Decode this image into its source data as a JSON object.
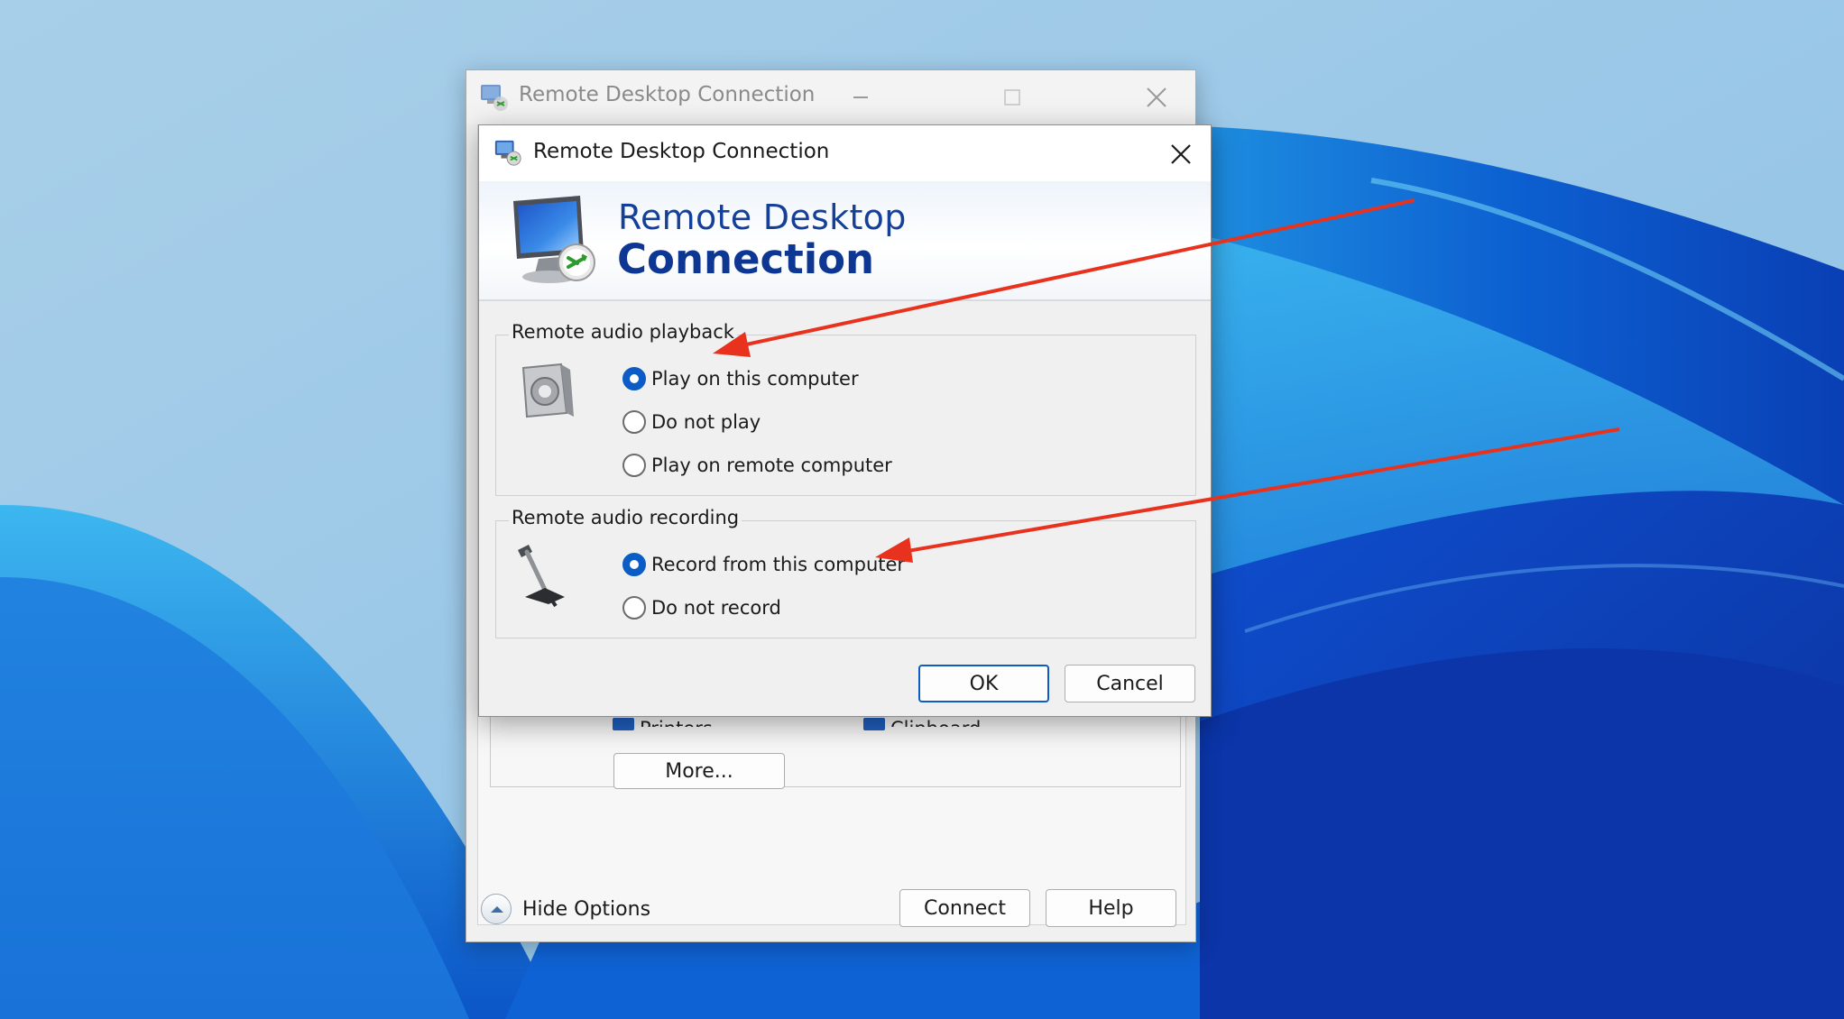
{
  "main_window": {
    "title": "Remote Desktop Connection",
    "local_resources": {
      "printers_label": "Printers",
      "clipboard_label": "Clipboard",
      "more_button": "More..."
    },
    "hide_options_label": "Hide Options",
    "connect_button": "Connect",
    "help_button": "Help"
  },
  "dialog": {
    "title": "Remote Desktop Connection",
    "banner": {
      "line1": "Remote Desktop",
      "line2": "Connection"
    },
    "playback_group": {
      "legend": "Remote audio playback",
      "options": [
        {
          "label": "Play on this computer",
          "checked": true
        },
        {
          "label": "Do not play",
          "checked": false
        },
        {
          "label": "Play on remote computer",
          "checked": false
        }
      ]
    },
    "recording_group": {
      "legend": "Remote audio recording",
      "options": [
        {
          "label": "Record from this computer",
          "checked": true
        },
        {
          "label": "Do not record",
          "checked": false
        }
      ]
    },
    "ok_button": "OK",
    "cancel_button": "Cancel"
  },
  "colors": {
    "accent": "#0b5cc5",
    "banner_text": "#15409a",
    "annotation_arrow": "#e8321e"
  },
  "icons": {
    "app": "remote-desktop-icon",
    "speaker": "speaker-icon",
    "microphone": "microphone-icon",
    "close": "close-icon",
    "minimize": "minimize-icon",
    "maximize": "maximize-icon",
    "collapse": "chevron-up-icon"
  }
}
